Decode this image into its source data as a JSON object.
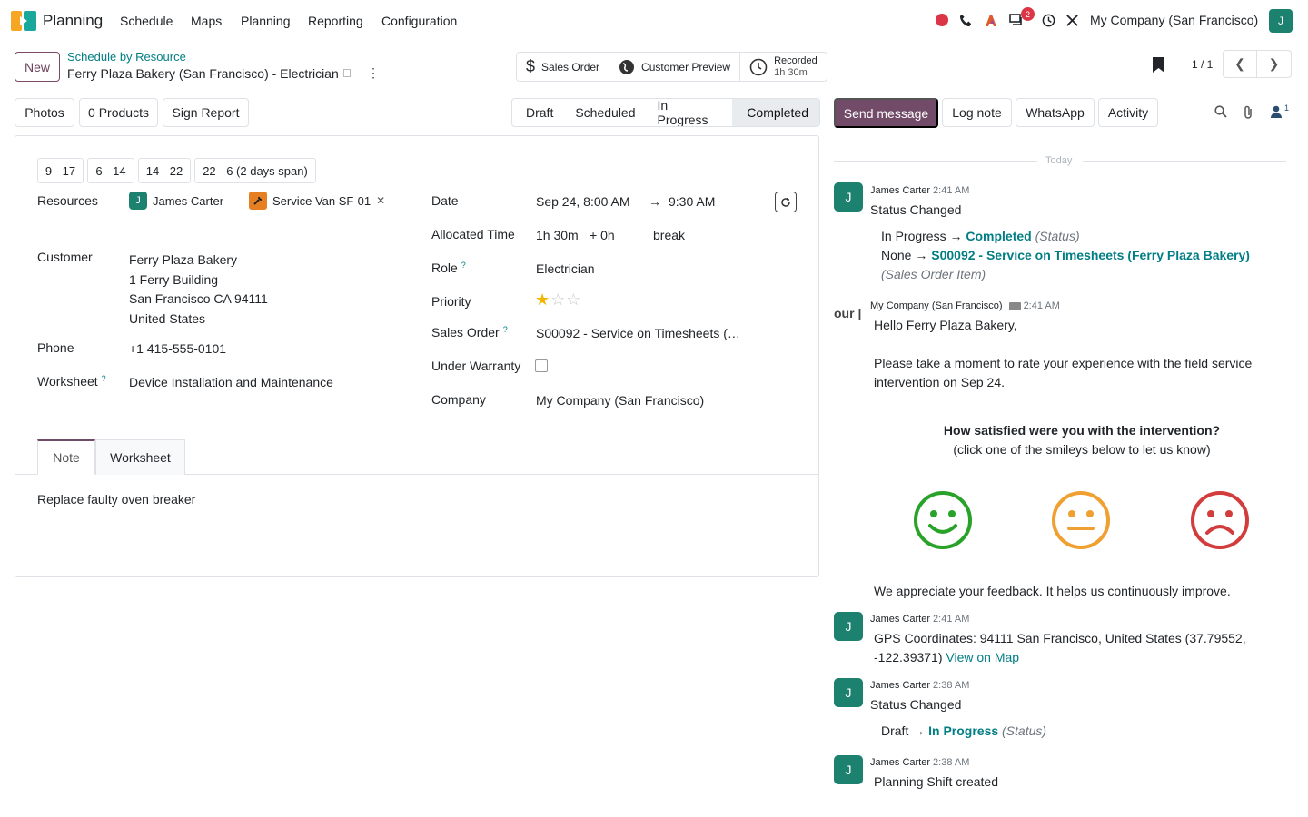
{
  "app": {
    "name": "Planning",
    "menu": [
      "Schedule",
      "Maps",
      "Planning",
      "Reporting",
      "Configuration"
    ],
    "company": "My Company (San Francisco)",
    "user_initial": "J",
    "msg_badge": "2"
  },
  "control": {
    "new_label": "New",
    "breadcrumb": "Schedule by Resource",
    "record_title": "Ferry Plaza Bakery (San Francisco) - Electrician",
    "pager": "1 / 1"
  },
  "stat_buttons": {
    "sales_order": "Sales Order",
    "customer_preview": "Customer Preview",
    "recorded_label": "Recorded",
    "recorded_value": "1h 30m"
  },
  "actions": {
    "photos": "Photos",
    "products": "0 Products",
    "sign_report": "Sign Report"
  },
  "stages": [
    "Draft",
    "Scheduled",
    "In Progress",
    "Completed"
  ],
  "chatter_buttons": {
    "send": "Send message",
    "log": "Log note",
    "whatsapp": "WhatsApp",
    "activity": "Activity",
    "followers": "1"
  },
  "shifts": [
    "9 - 17",
    "6 - 14",
    "14 - 22",
    "22 - 6 (2 days span)"
  ],
  "form": {
    "resources_label": "Resources",
    "resource1": "James Carter",
    "resource1_initial": "J",
    "resource2": "Service Van SF-01",
    "customer_label": "Customer",
    "customer_lines": [
      "Ferry Plaza Bakery",
      "1 Ferry Building",
      "San Francisco CA 94111",
      "United States"
    ],
    "phone_label": "Phone",
    "phone": "+1 415-555-0101",
    "worksheet_label": "Worksheet",
    "worksheet": "Device Installation and Maintenance",
    "date_label": "Date",
    "date_start": "Sep 24, 8:00 AM",
    "date_end": "9:30 AM",
    "alloc_label": "Allocated Time",
    "alloc": "1h 30m",
    "alloc_extra": "+ 0h",
    "break": "break",
    "role_label": "Role",
    "role": "Electrician",
    "priority_label": "Priority",
    "priority": 1,
    "priority_max": 3,
    "so_label": "Sales Order",
    "so": "S00092 - Service on Timesheets (…",
    "warranty_label": "Under Warranty",
    "company_label": "Company",
    "company": "My Company (San Francisco)",
    "help_mark": "?"
  },
  "tabs": {
    "note": "Note",
    "worksheet": "Worksheet",
    "note_content": "Replace faulty oven breaker"
  },
  "chatter": {
    "today": "Today",
    "m1": {
      "author": "James Carter",
      "time": "2:41 AM",
      "initial": "J",
      "body": "Status Changed",
      "t1_old": "In Progress",
      "t1_new": "Completed",
      "t1_field": "(Status)",
      "t2_old": "None",
      "t2_new": "S00092 - Service on Timesheets (Ferry Plaza Bakery)",
      "t2_field": "(Sales Order Item)"
    },
    "m2": {
      "author": "My Company (San Francisco)",
      "time": "2:41 AM",
      "logo": "our",
      "greet": "Hello Ferry Plaza Bakery,",
      "line1": "Please take a moment to rate your experience with the field service",
      "line2": "intervention on Sep 24.",
      "question": "How satisfied were you with the intervention?",
      "hint": "(click one of the smileys below to let us know)",
      "thanks": "We appreciate your feedback. It helps us continuously improve."
    },
    "m3": {
      "author": "James Carter",
      "time": "2:41 AM",
      "initial": "J",
      "line1": "GPS Coordinates: 94111 San Francisco, United States (37.79552,",
      "line2": "-122.39371)",
      "link": "View on Map"
    },
    "m4": {
      "author": "James Carter",
      "time": "2:38 AM",
      "initial": "J",
      "body": "Status Changed",
      "old": "Draft",
      "new": "In Progress",
      "field": "(Status)"
    },
    "m5": {
      "author": "James Carter",
      "time": "2:38 AM",
      "initial": "J",
      "body": "Planning Shift created"
    }
  },
  "colors": {
    "brand": "#714b67",
    "teal": "#017e84",
    "green": "#1d8170",
    "smile_good": "#28a228",
    "smile_ok": "#f0a030",
    "smile_bad": "#d23c3c"
  }
}
